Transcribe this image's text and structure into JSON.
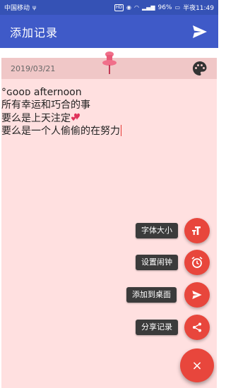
{
  "status_bar": {
    "carrier": "中国移动",
    "battery": "96%",
    "time": "半夜11:49",
    "hd_badge": "HD"
  },
  "app_bar": {
    "title": "添加记录",
    "send_icon": "send-icon"
  },
  "note": {
    "date": "2019/03/21",
    "pin_icon": "pushpin-icon",
    "palette_icon": "palette-icon",
    "lines": [
      "°ɢᴏᴏᴅ afternoon",
      "所有幸运和巧合的事",
      "要么是上天注定",
      "要么是一个人偷偷的在努力"
    ],
    "background": "#ffe0e0"
  },
  "fab_menu": {
    "items": [
      {
        "label": "字体大小",
        "icon": "font-size-icon"
      },
      {
        "label": "设置闹钟",
        "icon": "alarm-icon"
      },
      {
        "label": "添加到桌面",
        "icon": "send-icon"
      },
      {
        "label": "分享记录",
        "icon": "share-icon"
      }
    ],
    "close_label": "×",
    "accent": "#e8463c"
  },
  "colors": {
    "app_bar": "#3f5ac8",
    "status_bar": "#3552b5",
    "note_header": "#f0c7c7"
  }
}
